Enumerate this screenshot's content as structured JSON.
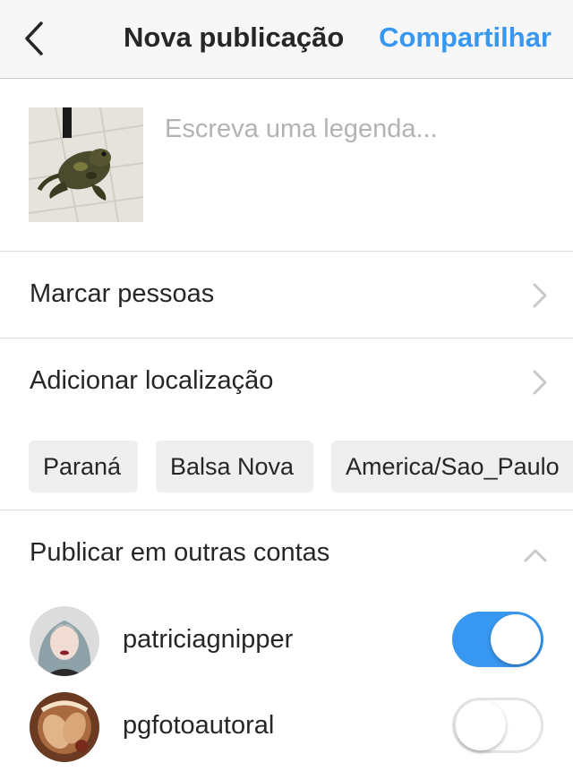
{
  "header": {
    "title": "Nova publicação",
    "share_label": "Compartilhar",
    "back_icon": "chevron-left-icon"
  },
  "caption": {
    "placeholder": "Escreva uma legenda...",
    "value": ""
  },
  "rows": {
    "tag_people": "Marcar pessoas",
    "add_location": "Adicionar localização"
  },
  "location_suggestions": [
    "Paraná",
    "Balsa Nova",
    "America/Sao_Paulo"
  ],
  "other_accounts": {
    "label": "Publicar em outras contas",
    "accounts": [
      {
        "username": "patriciagnipper",
        "enabled": true
      },
      {
        "username": "pgfotoautoral",
        "enabled": false
      }
    ]
  },
  "colors": {
    "accent": "#3897f0",
    "text": "#262626",
    "placeholder": "#b3b3b3",
    "chip_bg": "#efefef"
  }
}
